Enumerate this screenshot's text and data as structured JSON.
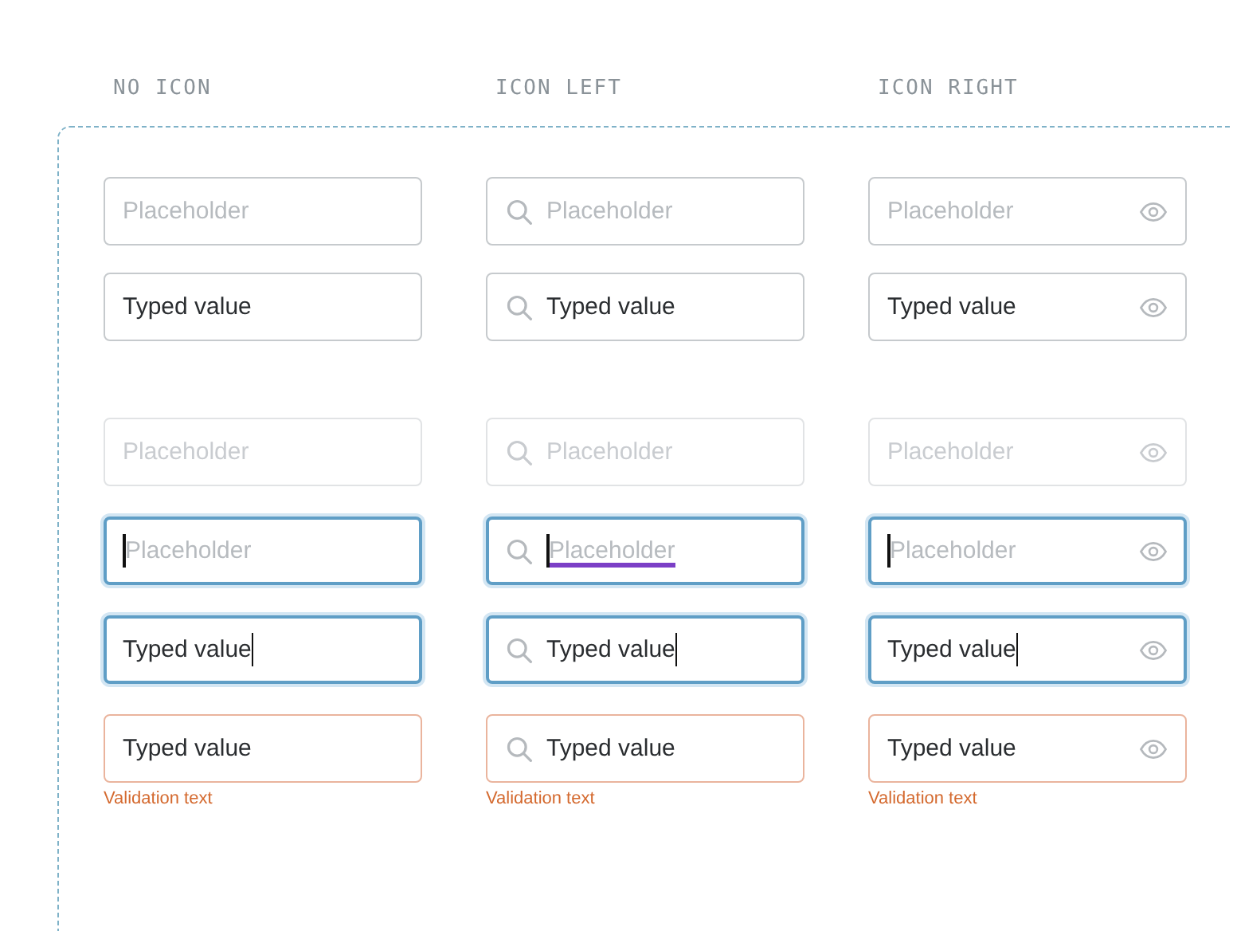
{
  "columns": [
    {
      "heading": "NO ICON",
      "kind": "plain",
      "groups": [
        [
          {
            "placeholder": "Placeholder",
            "disabled": false,
            "focused": false,
            "error": false,
            "underlined": false
          },
          {
            "value": "Typed value",
            "disabled": false,
            "focused": false,
            "error": false,
            "underlined": false
          }
        ],
        [
          {
            "placeholder": "Placeholder",
            "disabled": true,
            "focused": false,
            "error": false,
            "underlined": false
          },
          {
            "placeholder": "Placeholder",
            "disabled": false,
            "focused": true,
            "error": false,
            "underlined": false
          },
          {
            "value": "Typed value",
            "disabled": false,
            "focused": true,
            "error": false,
            "underlined": false
          },
          {
            "value": "Typed value",
            "validation": "Validation text",
            "disabled": false,
            "focused": false,
            "error": true,
            "underlined": false
          }
        ]
      ]
    },
    {
      "heading": "ICON LEFT",
      "kind": "leading",
      "groups": [
        [
          {
            "placeholder": "Placeholder",
            "disabled": false,
            "focused": false,
            "error": false,
            "underlined": false
          },
          {
            "value": "Typed value",
            "disabled": false,
            "focused": false,
            "error": false,
            "underlined": false
          }
        ],
        [
          {
            "placeholder": "Placeholder",
            "disabled": true,
            "focused": false,
            "error": false,
            "underlined": false
          },
          {
            "placeholder": "Placeholder",
            "disabled": false,
            "focused": true,
            "error": false,
            "underlined": true
          },
          {
            "value": "Typed value",
            "disabled": false,
            "focused": true,
            "error": false,
            "underlined": false
          },
          {
            "value": "Typed value",
            "validation": "Validation text",
            "disabled": false,
            "focused": false,
            "error": true,
            "underlined": false
          }
        ]
      ]
    },
    {
      "heading": "ICON RIGHT",
      "kind": "trailing",
      "groups": [
        [
          {
            "placeholder": "Placeholder",
            "disabled": false,
            "focused": false,
            "error": false,
            "underlined": false
          },
          {
            "value": "Typed value",
            "disabled": false,
            "focused": false,
            "error": false,
            "underlined": false
          }
        ],
        [
          {
            "placeholder": "Placeholder",
            "disabled": true,
            "focused": false,
            "error": false,
            "underlined": false
          },
          {
            "placeholder": "Placeholder",
            "disabled": false,
            "focused": true,
            "error": false,
            "underlined": false
          },
          {
            "value": "Typed value",
            "disabled": false,
            "focused": true,
            "error": false,
            "underlined": false
          },
          {
            "value": "Typed value",
            "validation": "Validation text",
            "disabled": false,
            "focused": false,
            "error": true,
            "underlined": false
          }
        ]
      ]
    }
  ]
}
